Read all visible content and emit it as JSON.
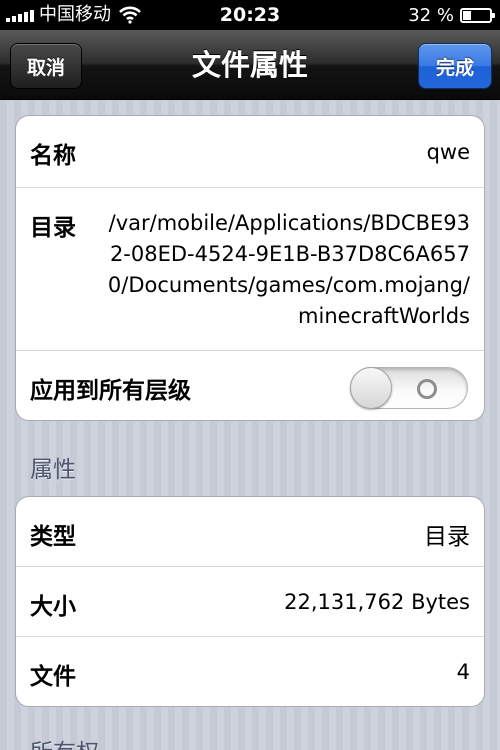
{
  "status_bar": {
    "carrier": "中国移动",
    "time": "20:23",
    "battery": "32 %",
    "battery_level": 0.32
  },
  "nav": {
    "title": "文件属性",
    "cancel_label": "取消",
    "done_label": "完成"
  },
  "info_group": {
    "name_label": "名称",
    "name_value": "qwe",
    "dir_label": "目录",
    "dir_value": "/var/mobile/Applications/BDCBE932-08ED-4524-9E1B-B37D8C6A6570/Documents/games/com.mojang/minecraftWorlds",
    "apply_label": "应用到所有层级",
    "apply_enabled": false
  },
  "attributes": {
    "header": "属性",
    "type_label": "类型",
    "type_value": "目录",
    "size_label": "大小",
    "size_value": "22,131,762 Bytes",
    "files_label": "文件",
    "files_value": "4"
  },
  "ownership": {
    "header": "所有权"
  },
  "colors": {
    "done_button": "#2368dc",
    "navbar": "#1e1e1e",
    "section_header": "#4c566c"
  },
  "icons": [
    "signal-bars-icon",
    "wifi-icon",
    "battery-icon"
  ]
}
